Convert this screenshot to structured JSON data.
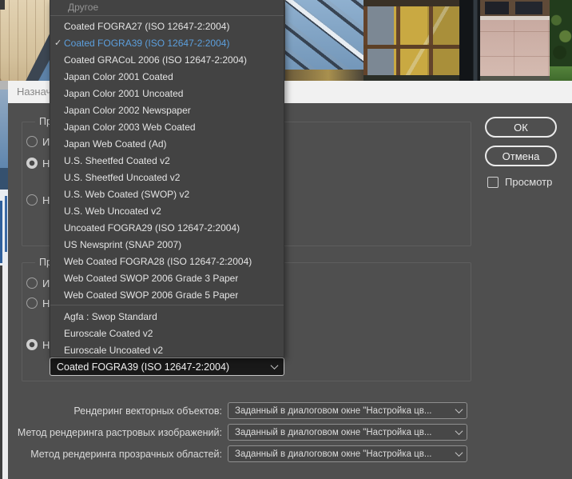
{
  "window": {
    "title": "Назначи"
  },
  "popup": {
    "header": "Другое",
    "check_glyph": "✓",
    "accent_color": "#5c9fdd",
    "items": [
      {
        "label": "Coated FOGRA27 (ISO 12647-2:2004)"
      },
      {
        "label": "Coated FOGRA39 (ISO 12647-2:2004)",
        "checked": true,
        "highlight": true
      },
      {
        "label": "Coated GRACoL 2006 (ISO 12647-2:2004)"
      },
      {
        "label": "Japan Color 2001 Coated"
      },
      {
        "label": "Japan Color 2001 Uncoated"
      },
      {
        "label": "Japan Color 2002 Newspaper"
      },
      {
        "label": "Japan Color 2003 Web Coated"
      },
      {
        "label": "Japan Web Coated (Ad)"
      },
      {
        "label": "U.S. Sheetfed Coated v2"
      },
      {
        "label": "U.S. Sheetfed Uncoated v2"
      },
      {
        "label": "U.S. Web Coated (SWOP) v2"
      },
      {
        "label": "U.S. Web Uncoated v2"
      },
      {
        "label": "Uncoated FOGRA29 (ISO 12647-2:2004)"
      },
      {
        "label": "US Newsprint (SNAP 2007)"
      },
      {
        "label": "Web Coated FOGRA28 (ISO 12647-2:2004)"
      },
      {
        "label": "Web Coated SWOP 2006 Grade 3 Paper"
      },
      {
        "label": "Web Coated SWOP 2006 Grade 5 Paper",
        "separator_after": true
      },
      {
        "label": "Agfa : Swop Standard"
      },
      {
        "label": "Euroscale Coated v2"
      },
      {
        "label": "Euroscale Uncoated v2"
      }
    ]
  },
  "groups": [
    {
      "label": "Прос",
      "radios": [
        {
          "label": "И",
          "selected": false
        },
        {
          "label": "Н",
          "selected": true
        },
        {
          "label": "Н",
          "selected": false
        }
      ]
    },
    {
      "label": "Прос",
      "radios": [
        {
          "label": "И",
          "selected": false
        },
        {
          "label": "Н",
          "selected": false
        },
        {
          "label": "Н",
          "selected": true
        }
      ],
      "combo_value": "Coated FOGRA39 (ISO 12647-2:2004)"
    }
  ],
  "buttons": {
    "ok": "ОК",
    "cancel": "Отмена"
  },
  "preview_checkbox": {
    "label": "Просмотр",
    "checked": false
  },
  "bottom_rows": [
    {
      "label": "Рендеринг векторных объектов:",
      "value": "Заданный в диалоговом окне \"Настройка цв..."
    },
    {
      "label": "Метод рендеринга растровых изображений:",
      "value": "Заданный в диалоговом окне \"Настройка цв..."
    },
    {
      "label": "Метод рендеринга прозрачных областей:",
      "value": "Заданный в диалоговом окне \"Настройка цв..."
    }
  ],
  "colors": {
    "dialog_bg": "#4f4f4f",
    "popup_bg": "#434343",
    "titlebar_bg": "#f1f1f1",
    "accent_blue": "#5c9fdd"
  }
}
